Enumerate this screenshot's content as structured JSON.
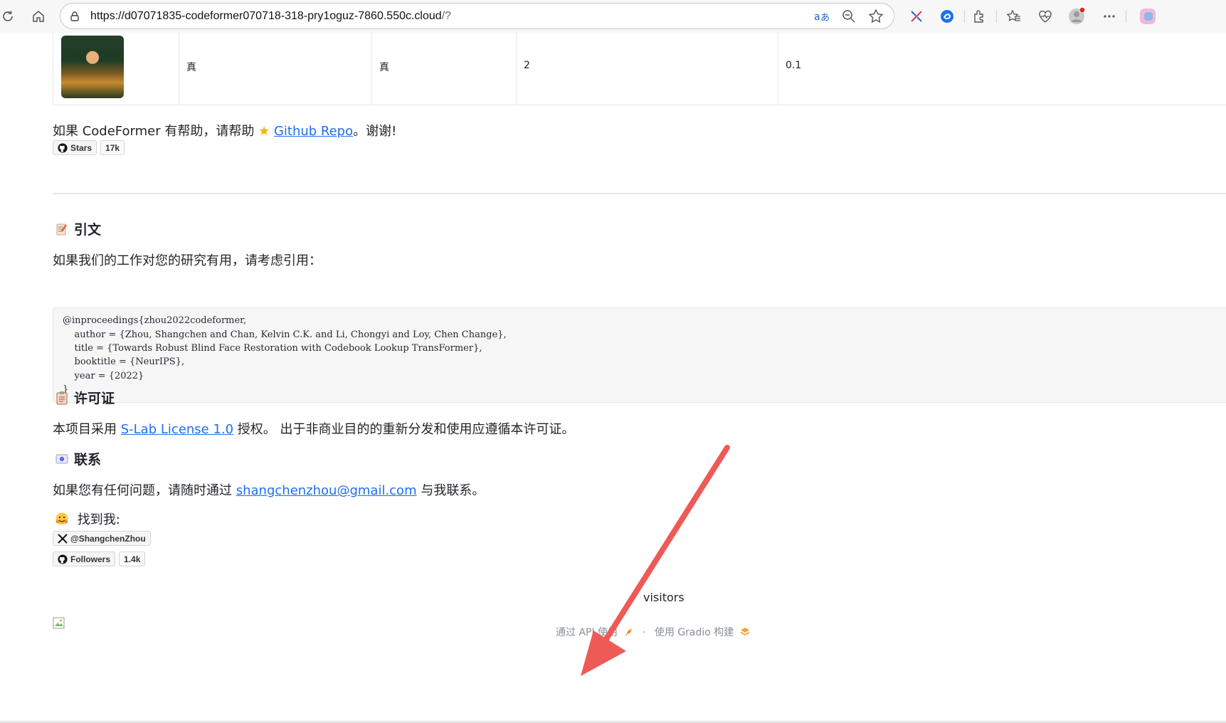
{
  "browser": {
    "url_host": "https://d07071835-codeformer070718-318-pry1oguz-7860.550c.cloud",
    "url_rest": "/?",
    "icons": [
      "reload-icon",
      "home-icon",
      "lock-icon",
      "translate-icon",
      "zoom-icon",
      "favorite-star-icon",
      "copilot-icon",
      "edge-bar-icon",
      "extensions-icon",
      "favorites-icon",
      "health-icon",
      "profile-icon",
      "more-icon",
      "copilot-app-icon"
    ]
  },
  "table": {
    "col2": "真",
    "col3": "真",
    "col4": "2",
    "col5": "0.1"
  },
  "star_line": {
    "prefix": "如果 CodeFormer 有帮助，请帮助 ",
    "link": "Github Repo",
    "suffix": "。谢谢!"
  },
  "badges": {
    "stars_label": "Stars",
    "stars_count": "17k",
    "twitter_label": "@ShangchenZhou",
    "followers_label": "Followers",
    "followers_count": "1.4k"
  },
  "citation": {
    "heading": "引文",
    "intro": "如果我们的工作对您的研究有用，请考虑引用：",
    "code": [
      "@inproceedings{zhou2022codeformer,",
      "    author = {Zhou, Shangchen and Chan, Kelvin C.K. and Li, Chongyi and Loy, Chen Change},",
      "    title = {Towards Robust Blind Face Restoration with Codebook Lookup TransFormer},",
      "    booktitle = {NeurIPS},",
      "    year = {2022}",
      "}"
    ]
  },
  "license": {
    "heading": "许可证",
    "prefix": "本项目采用 ",
    "link": "S-Lab License 1.0",
    "suffix": " 授权。 出于非商业目的的重新分发和使用应遵循本许可证。"
  },
  "contact": {
    "heading": "联系",
    "prefix": "如果您有任何问题，请随时通过 ",
    "email": "shangchenzhou@gmail.com",
    "suffix": " 与我联系。",
    "find_me": "找到我:"
  },
  "visitors": "visitors",
  "footer": {
    "api": "通过 API 使用",
    "dot": "·",
    "gradio": "使用 Gradio 构建"
  },
  "colors": {
    "link": "#1f6feb",
    "arrow": "#ee5a55"
  }
}
